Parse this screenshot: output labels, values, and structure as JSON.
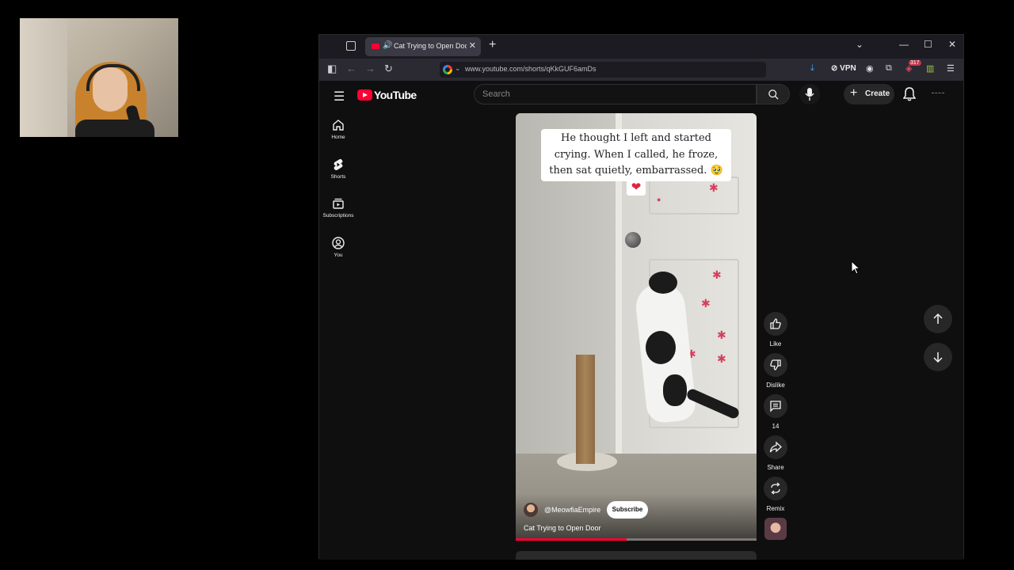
{
  "browser": {
    "tab_title": "Cat Trying to Open Door - Y",
    "url": "www.youtube.com/shorts/qKkGUF6amDs",
    "vpn_label": "VPN",
    "extension_badge": "317"
  },
  "youtube": {
    "logo_text": "YouTube",
    "search_placeholder": "Search",
    "create_label": "Create",
    "sidebar": [
      {
        "label": "Home",
        "icon": "home-icon"
      },
      {
        "label": "Shorts",
        "icon": "shorts-icon"
      },
      {
        "label": "Subscriptions",
        "icon": "subscriptions-icon"
      },
      {
        "label": "You",
        "icon": "you-icon"
      }
    ]
  },
  "short": {
    "caption_lines": [
      "He thought I left and started",
      "crying. When I called, he froze,",
      "then sat quietly, embarrassed. 🥹"
    ],
    "caption_heart": "❤",
    "channel": "@MeowfiaEmpire",
    "subscribe_label": "Subscribe",
    "title": "Cat Trying to Open Door",
    "progress_fraction": 0.46
  },
  "actions": {
    "like": "Like",
    "dislike": "Dislike",
    "comments": "14",
    "share": "Share",
    "remix": "Remix"
  },
  "colors": {
    "brand_red": "#ff0033",
    "background": "#0f0f0f"
  }
}
